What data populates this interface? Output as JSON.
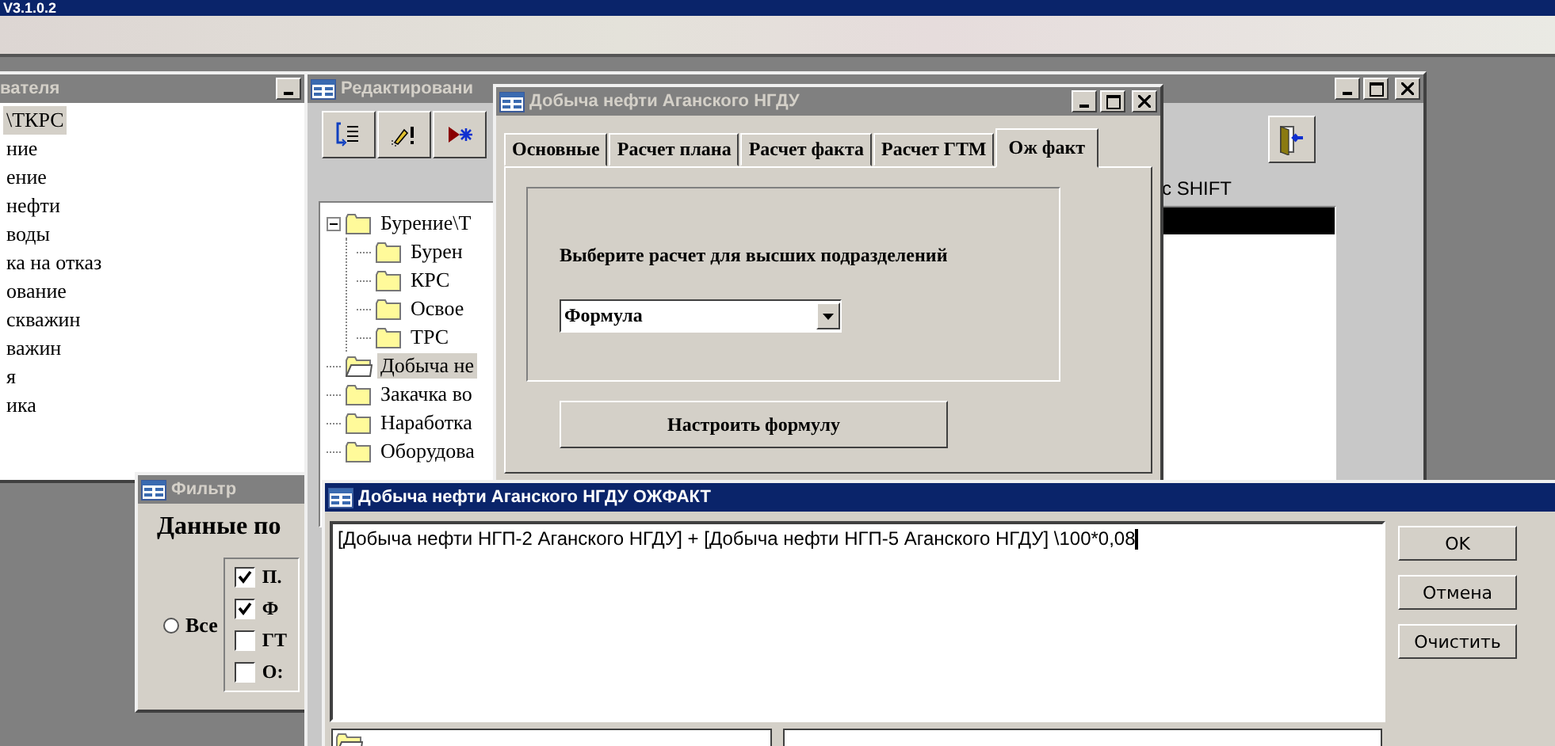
{
  "app_title": "V3.1.0.2",
  "user_window": {
    "title": "вателя",
    "active": false,
    "items": [
      {
        "label": "\\ТКРС",
        "selected": true
      },
      {
        "label": "ние",
        "selected": false
      },
      {
        "label": "ение",
        "selected": false
      },
      {
        "label": "нефти",
        "selected": false
      },
      {
        "label": "воды",
        "selected": false
      },
      {
        "label": "ка на отказ",
        "selected": false
      },
      {
        "label": "ование",
        "selected": false
      },
      {
        "label": "скважин",
        "selected": false
      },
      {
        "label": "важин",
        "selected": false
      },
      {
        "label": "я",
        "selected": false
      },
      {
        "label": "ика",
        "selected": false
      }
    ]
  },
  "filter_window": {
    "title": "Фильтр",
    "active": false,
    "heading": "Данные по",
    "radio": {
      "label": "Все",
      "selected": false
    },
    "checks": [
      {
        "label": "П.",
        "checked": true
      },
      {
        "label": "Ф",
        "checked": true
      },
      {
        "label": "ГТ",
        "checked": false
      },
      {
        "label": "О:",
        "checked": false
      }
    ]
  },
  "editor_window": {
    "title": "Редактировани",
    "active": false,
    "hint": "с SHIFT",
    "tree": [
      {
        "label": "Бурение\\Т",
        "selected": false,
        "expanded": true,
        "children": [
          {
            "label": "Бурен",
            "selected": false,
            "expanded": false
          },
          {
            "label": "КРС",
            "selected": false,
            "expanded": false
          },
          {
            "label": "Освое",
            "selected": false,
            "expanded": false
          },
          {
            "label": "ТРС",
            "selected": false,
            "expanded": false
          }
        ]
      },
      {
        "label": "Добыча не",
        "selected": true,
        "expanded": false
      },
      {
        "label": "Закачка во",
        "selected": false,
        "expanded": false
      },
      {
        "label": "Наработка",
        "selected": false,
        "expanded": false
      },
      {
        "label": "Оборудова",
        "selected": false,
        "expanded": false
      }
    ]
  },
  "plan_window": {
    "title": "Добыча нефти Аганского НГДУ",
    "active": false,
    "tabs": [
      {
        "label": "Основные",
        "selected": false
      },
      {
        "label": "Расчет плана",
        "selected": false
      },
      {
        "label": "Расчет факта",
        "selected": false
      },
      {
        "label": "Расчет ГТМ",
        "selected": false
      },
      {
        "label": "Ож факт",
        "selected": true
      }
    ],
    "prompt": "Выберите расчет для высших подразделений",
    "calc_select": {
      "value": "Формула"
    },
    "configure_button": "Настроить формулу"
  },
  "formula_window": {
    "title": "Добыча нефти Аганского НГДУ ОЖФАКТ",
    "active": true,
    "formula": "[Добыча нефти НГП-2 Аганского НГДУ] + [Добыча нефти НГП-5 Аганского НГДУ] \\100*0,08",
    "buttons": [
      "OK",
      "Отмена",
      "Очистить"
    ]
  }
}
